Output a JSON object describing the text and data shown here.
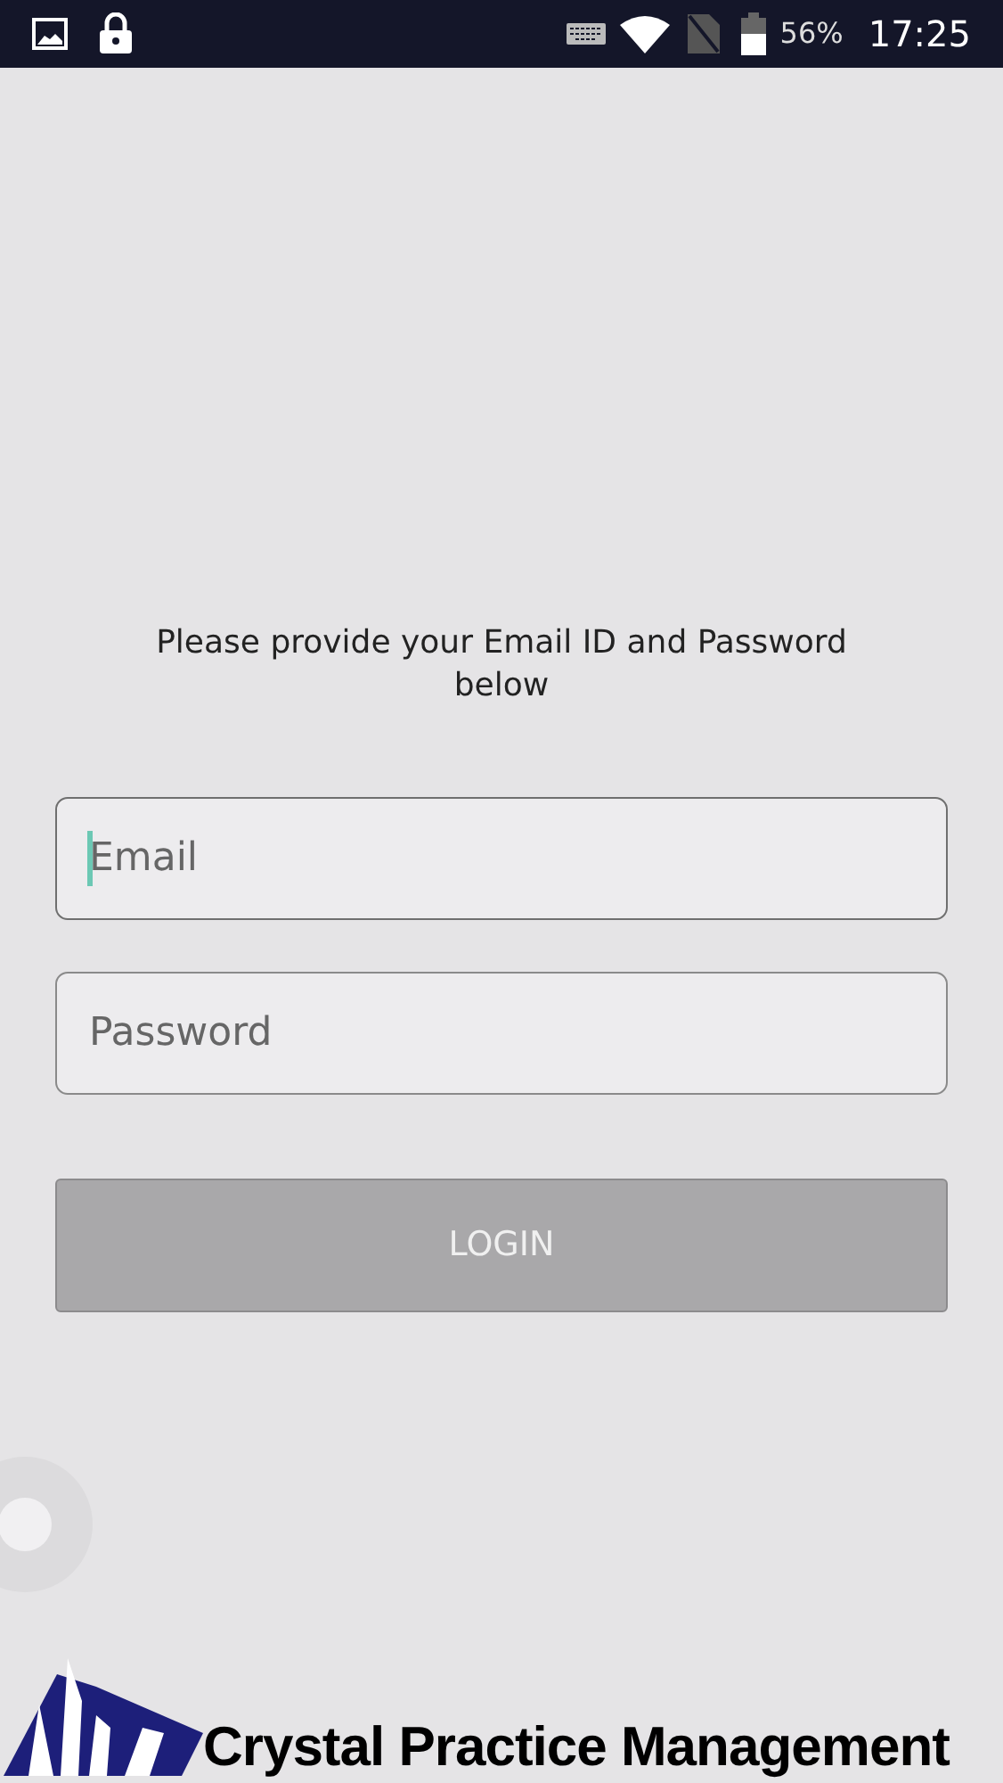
{
  "status_bar": {
    "battery": "56%",
    "time": "17:25"
  },
  "instruction": "Please provide your Email ID and Password below",
  "fields": [
    {
      "placeholder": "Email",
      "focused": true
    },
    {
      "placeholder": "Password",
      "focused": false
    }
  ],
  "login_button": {
    "label": "LOGIN",
    "disabled": true
  },
  "logo": {
    "text": "Crystal Practice Management"
  }
}
